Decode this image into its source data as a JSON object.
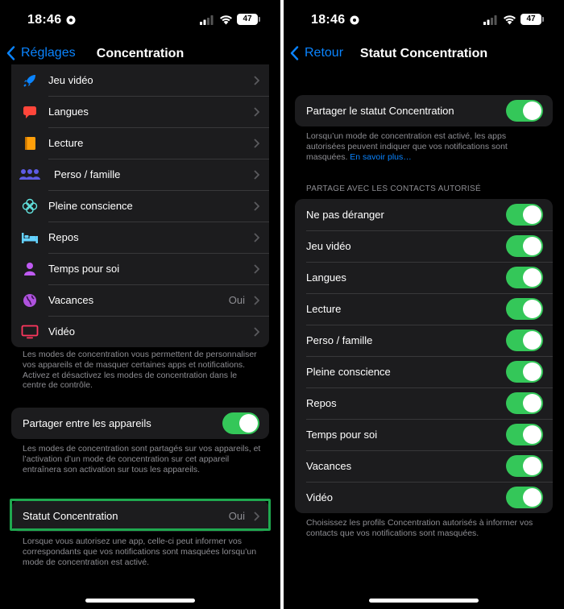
{
  "status_bar": {
    "time": "18:46",
    "battery": "47"
  },
  "left_screen": {
    "nav": {
      "back_label": "Réglages",
      "title": "Concentration"
    },
    "focus_modes": [
      {
        "label": "Jeu vidéo",
        "value": "",
        "icon": "rocket-icon",
        "color": "#0a84ff"
      },
      {
        "label": "Langues",
        "value": "",
        "icon": "speech-bubble-icon",
        "color": "#ff453a"
      },
      {
        "label": "Lecture",
        "value": "",
        "icon": "book-icon",
        "color": "#ff9f0a"
      },
      {
        "label": "Perso / famille",
        "value": "",
        "icon": "people-icon",
        "color": "#5e5ce6"
      },
      {
        "label": "Pleine conscience",
        "value": "",
        "icon": "mindfulness-flower-icon",
        "color": "#63e6e2"
      },
      {
        "label": "Repos",
        "value": "",
        "icon": "bed-icon",
        "color": "#64d2ff"
      },
      {
        "label": "Temps pour soi",
        "value": "",
        "icon": "person-icon",
        "color": "#bf5af2"
      },
      {
        "label": "Vacances",
        "value": "Oui",
        "icon": "globe-icon",
        "color": "#af52de"
      },
      {
        "label": "Vidéo",
        "value": "",
        "icon": "tv-icon",
        "color": "#ff375f"
      }
    ],
    "modes_footnote": "Les modes de concentration vous permettent de personnaliser vos appareils et de masquer certaines apps et notifications. Activez et désactivez les modes de concentration dans le centre de contrôle.",
    "share_devices": {
      "label": "Partager entre les appareils",
      "enabled": true
    },
    "share_footnote": "Les modes de concentration sont partagés sur vos appareils, et l’activation d’un mode de concentration sur cet appareil entraînera son activation sur tous les appareils.",
    "focus_status": {
      "label": "Statut Concentration",
      "value": "Oui"
    },
    "status_footnote": "Lorsque vous autorisez une app, celle-ci peut informer vos correspondants que vos notifications sont masquées lorsqu’un mode de concentration est activé."
  },
  "right_screen": {
    "nav": {
      "back_label": "Retour",
      "title": "Statut Concentration"
    },
    "share_status": {
      "label": "Partager le statut Concentration",
      "enabled": true
    },
    "share_footnote": "Lorsqu’un mode de concentration est activé, les apps autorisées peuvent indiquer que vos notifications sont masquées.",
    "learn_more": "En savoir plus…",
    "section_header": "PARTAGE AVEC LES CONTACTS AUTORISÉ",
    "contact_modes": [
      {
        "label": "Ne pas déranger",
        "enabled": true
      },
      {
        "label": "Jeu vidéo",
        "enabled": true
      },
      {
        "label": "Langues",
        "enabled": true
      },
      {
        "label": "Lecture",
        "enabled": true
      },
      {
        "label": "Perso / famille",
        "enabled": true
      },
      {
        "label": "Pleine conscience",
        "enabled": true
      },
      {
        "label": "Repos",
        "enabled": true
      },
      {
        "label": "Temps pour soi",
        "enabled": true
      },
      {
        "label": "Vacances",
        "enabled": true
      },
      {
        "label": "Vidéo",
        "enabled": true
      }
    ],
    "contacts_footnote": "Choisissez les profils Concentration autorisés à informer vos contacts que vos notifications sont masquées."
  },
  "colors": {
    "accent": "#0a84ff",
    "toggle_on": "#34c759",
    "highlight": "#1fa84f",
    "cell_bg": "#1c1c1e",
    "secondary_text": "#8e8e93"
  }
}
